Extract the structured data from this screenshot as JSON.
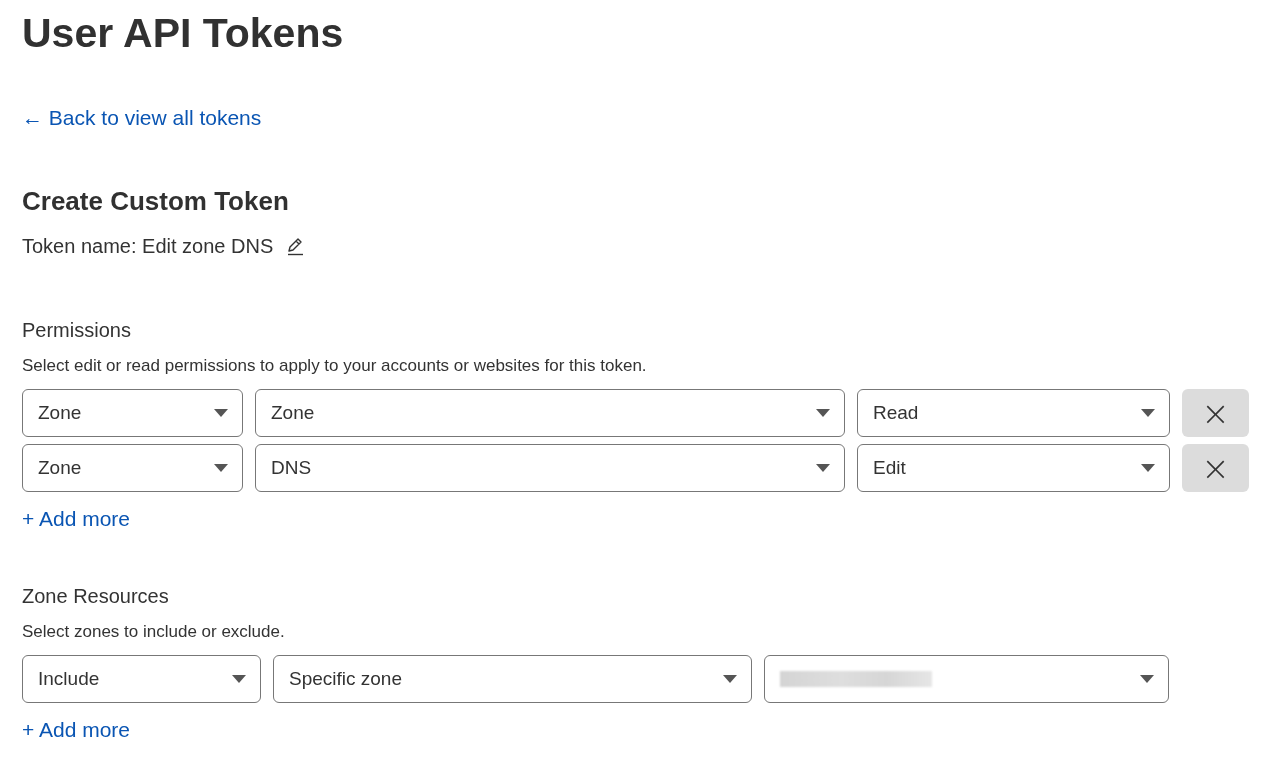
{
  "title": "User API Tokens",
  "back_link": {
    "arrow": "←",
    "label": "Back to view all tokens"
  },
  "heading": "Create Custom Token",
  "token_name": "Token name: Edit zone DNS",
  "permissions": {
    "title": "Permissions",
    "description": "Select edit or read permissions to apply to your accounts or websites for this token.",
    "rows": [
      {
        "selects": [
          {
            "value": "Zone"
          },
          {
            "value": "Zone"
          },
          {
            "value": "Read"
          }
        ],
        "remove": "×"
      },
      {
        "selects": [
          {
            "value": "Zone"
          },
          {
            "value": "DNS"
          },
          {
            "value": "Edit"
          }
        ],
        "remove": "×"
      }
    ],
    "add_more": {
      "plus": "+",
      "label": "Add more"
    }
  },
  "zone_resources": {
    "title": "Zone Resources",
    "description": "Select zones to include or exclude.",
    "rows": [
      {
        "selects": [
          {
            "value": "Include"
          },
          {
            "value": "Specific zone"
          },
          {
            "kind": "redacted"
          }
        ]
      }
    ],
    "add_more": {
      "plus": "+",
      "label": "Add more"
    }
  }
}
